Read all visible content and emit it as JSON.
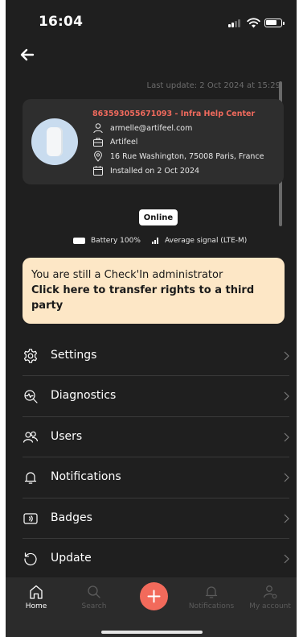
{
  "status_bar": {
    "time": "16:04"
  },
  "header": {
    "last_update": "Last update: 2 Oct 2024 at 15:29"
  },
  "device": {
    "title": "863593055671093 - Infra Help Center",
    "email": "armelle@artifeel.com",
    "company": "Artifeel",
    "address": "16 Rue Washington, 75008 Paris, France",
    "installed": "Installed on 2 Oct 2024"
  },
  "status": {
    "online_label": "Online",
    "battery": "Battery 100%",
    "signal": "Average signal (LTE-M)"
  },
  "admin_banner": {
    "line1": "You are still a Check'In administrator",
    "line2": "Click here to transfer rights to a third party"
  },
  "menu": {
    "items": [
      {
        "label": "Settings",
        "icon": "gear-icon"
      },
      {
        "label": "Diagnostics",
        "icon": "diagnostics-icon"
      },
      {
        "label": "Users",
        "icon": "users-icon"
      },
      {
        "label": "Notifications",
        "icon": "bell-icon"
      },
      {
        "label": "Badges",
        "icon": "badge-icon"
      },
      {
        "label": "Update",
        "icon": "update-icon"
      }
    ]
  },
  "tab_bar": {
    "home": "Home",
    "search": "Search",
    "notifications": "Notifications",
    "account": "My account"
  },
  "colors": {
    "background": "#1f1f1f",
    "card": "#2e2e2e",
    "accent": "#f26a5b",
    "banner": "#fde7c6"
  }
}
